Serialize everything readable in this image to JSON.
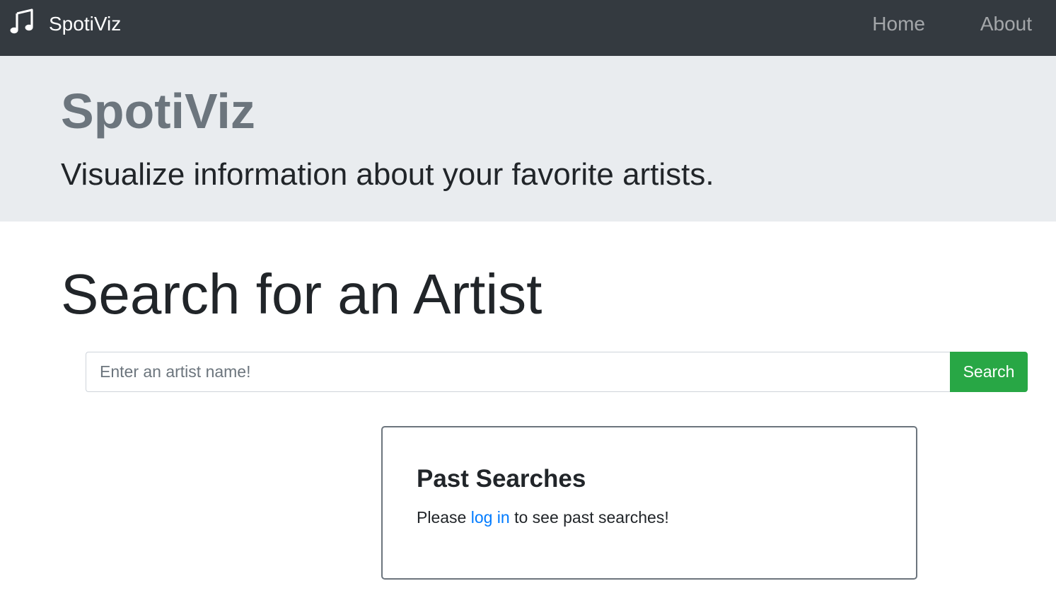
{
  "navbar": {
    "brand": "SpotiViz",
    "brand_icon": "music-note-icon",
    "links": [
      "Home",
      "About"
    ]
  },
  "jumbotron": {
    "title": "SpotiViz",
    "lead": "Visualize information about your favorite artists."
  },
  "search": {
    "heading": "Search for an Artist",
    "placeholder": "Enter an artist name!",
    "value": "",
    "button_label": "Search"
  },
  "past_searches": {
    "title": "Past Searches",
    "text_before": "Please",
    "link_text": "log in",
    "text_after": "to see past searches!"
  },
  "colors": {
    "navbar_bg": "#343a40",
    "jumbotron_bg": "#e9ecef",
    "search_button": "#28a745",
    "link": "#007bff"
  }
}
